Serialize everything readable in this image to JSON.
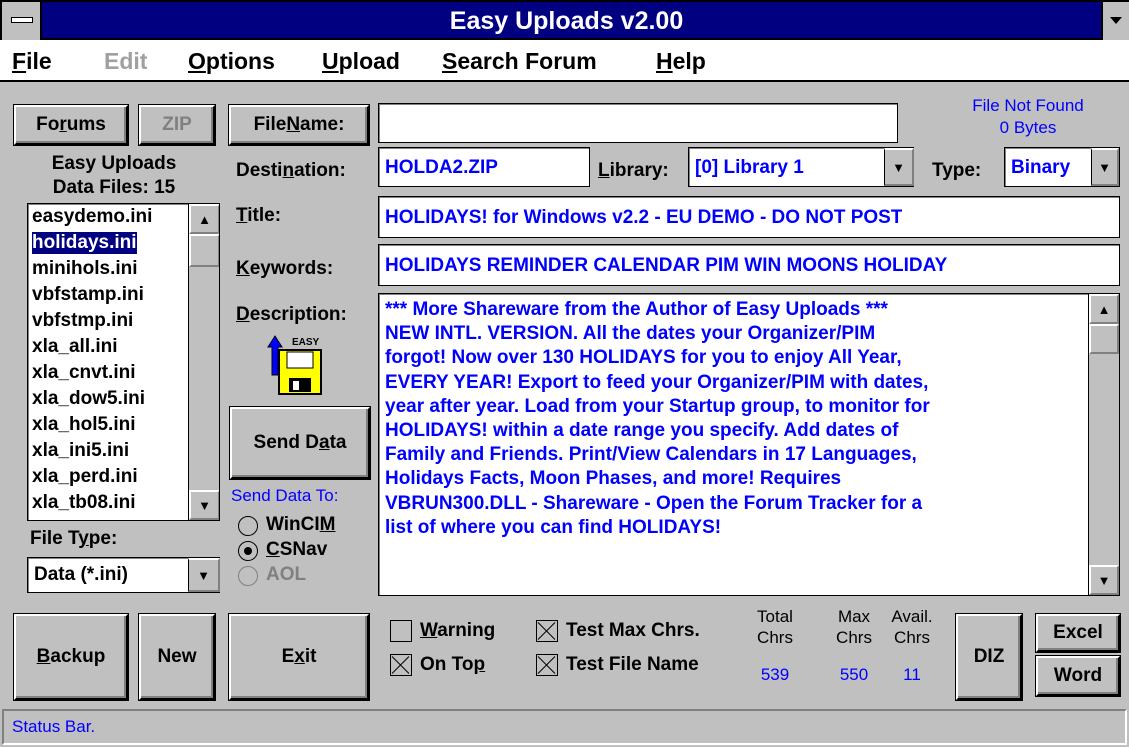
{
  "window": {
    "title": "Easy Uploads v2.00"
  },
  "menu": {
    "file": {
      "label": "File",
      "hotkey": "F",
      "rest": "ile"
    },
    "edit": {
      "label": "Edit"
    },
    "options": {
      "hotkey": "O",
      "rest": "ptions"
    },
    "upload": {
      "hotkey": "U",
      "rest": "pload"
    },
    "search": {
      "hotkey": "S",
      "rest": "earch Forum"
    },
    "help": {
      "hotkey": "H",
      "rest": "elp"
    }
  },
  "buttons": {
    "forums": {
      "pre": "Fo",
      "hot": "r",
      "post": "ums"
    },
    "zip": "ZIP",
    "file_name": {
      "pre": "File ",
      "hot": "N",
      "post": "ame:"
    },
    "send_data": {
      "pre": "Send D",
      "hot": "a",
      "post": "ta"
    },
    "backup": {
      "hot": "B",
      "post": "ackup"
    },
    "new": "New",
    "exit": {
      "pre": "E",
      "hot": "x",
      "post": "it"
    },
    "diz": "DIZ",
    "excel": "Excel",
    "word": "Word"
  },
  "file_status": {
    "line1": "File Not Found",
    "line2": "0 Bytes"
  },
  "data_files": {
    "line1": "Easy Uploads",
    "line2": "Data Files: 15"
  },
  "file_list": {
    "items": [
      "easydemo.ini",
      "holidays.ini",
      "minihols.ini",
      "vbfstamp.ini",
      "vbfstmp.ini",
      "xla_all.ini",
      "xla_cnvt.ini",
      "xla_dow5.ini",
      "xla_hol5.ini",
      "xla_ini5.ini",
      "xla_perd.ini",
      "xla_tb08.ini"
    ],
    "selected_index": 1
  },
  "file_type": {
    "label_pre": "File T",
    "label_hot": "y",
    "label_post": "pe:",
    "value": "Data (*.ini)"
  },
  "fields": {
    "destination": {
      "label_pre": "Desti",
      "label_hot": "n",
      "label_post": "ation:",
      "value": "HOLDA2.ZIP"
    },
    "library": {
      "label_hot": "L",
      "label_post": "ibrary:",
      "value": "[0] Library 1"
    },
    "type": {
      "label": "Type:",
      "value": "Binary"
    },
    "title": {
      "label_hot": "T",
      "label_post": "itle:",
      "value": "HOLIDAYS! for Windows v2.2 - EU DEMO - DO NOT POST"
    },
    "keywords": {
      "label_hot": "K",
      "label_post": "eywords:",
      "value": "HOLIDAYS REMINDER CALENDAR PIM WIN MOONS HOLIDAY"
    },
    "description": {
      "label_hot": "D",
      "label_post": "escription:",
      "lines": [
        "*** More Shareware from the Author of Easy Uploads ***",
        "NEW INTL. VERSION. All the dates your Organizer/PIM",
        "forgot! Now over 130 HOLIDAYS for you to enjoy All Year,",
        "EVERY YEAR! Export to feed your Organizer/PIM with dates,",
        "year after year. Load from your Startup group, to monitor for",
        "HOLIDAYS! within a date range you specify. Add dates of",
        "Family and Friends. Print/View Calendars in 17 Languages,",
        "Holidays Facts, Moon Phases, and more!  Requires",
        "VBRUN300.DLL - Shareware - Open the Forum Tracker for a",
        "list of where you can find HOLIDAYS!"
      ]
    }
  },
  "logo_text": "EASY",
  "send_to": {
    "label": "Send Data To:",
    "wincim": {
      "pre": "WinCI",
      "hot": "M",
      "checked": false
    },
    "csnav": {
      "hot": "C",
      "post": "SNav",
      "checked": true
    },
    "aol": {
      "label": "AOL",
      "enabled": false
    }
  },
  "options": {
    "warning": {
      "hot": "W",
      "post": "arning",
      "checked": false
    },
    "test_max": {
      "label": "Test Max Chrs.",
      "checked": true
    },
    "on_top": {
      "pre": "On To",
      "hot": "p",
      "checked": true
    },
    "test_file": {
      "label": "Test File Name",
      "checked": true
    }
  },
  "stats": {
    "total": {
      "l1": "Total",
      "l2": "Chrs",
      "value": "539"
    },
    "max": {
      "l1": "Max",
      "l2": "Chrs",
      "value": "550"
    },
    "avail": {
      "l1": "Avail.",
      "l2": "Chrs",
      "value": "11"
    }
  },
  "status_bar": {
    "text": "Status Bar."
  },
  "colors": {
    "titlebar": "#000080",
    "field_text": "#0000ff",
    "face": "#c0c0c0"
  }
}
